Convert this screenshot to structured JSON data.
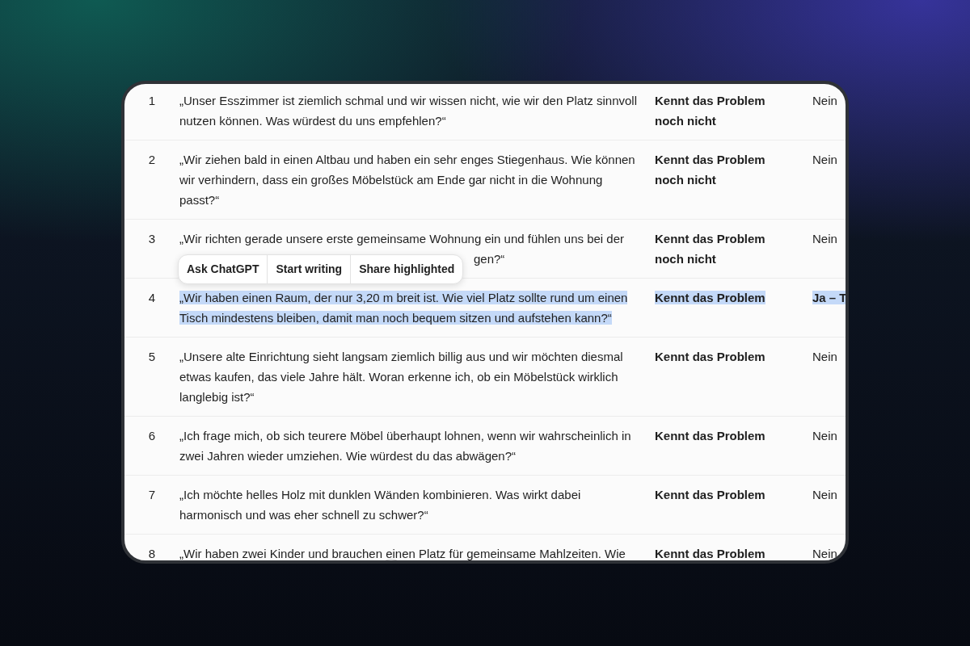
{
  "rows": [
    {
      "number": "1",
      "question": "„Unser Esszimmer ist ziemlich schmal und wir wissen nicht, wie wir den Platz sinnvoll nutzen können. Was würdest du uns empfehlen?“",
      "status": "Kennt das Problem noch nicht",
      "answer": "Nein",
      "selected": false
    },
    {
      "number": "2",
      "question": "„Wir ziehen bald in einen Altbau und haben ein sehr enges Stiegenhaus. Wie können wir verhindern, dass ein großes Möbelstück am Ende gar nicht in die Wohnung passt?“",
      "status": "Kennt das Problem noch nicht",
      "answer": "Nein",
      "selected": false
    },
    {
      "number": "3",
      "question": "„Wir richten gerade unsere erste gemeinsame Wohnung ein und fühlen uns bei der",
      "question_tail": "gen?“",
      "status": "Kennt das Problem noch nicht",
      "answer": "Nein",
      "selected": false
    },
    {
      "number": "4",
      "question": "„Wir haben einen Raum, der nur 3,20 m breit ist. Wie viel Platz sollte rund um einen Tisch mindestens bleiben, damit man noch bequem sitzen und aufstehen kann?“",
      "status": "Kennt das Problem",
      "answer": "Ja – T",
      "selected": true
    },
    {
      "number": "5",
      "question": "„Unsere alte Einrichtung sieht langsam ziemlich billig aus und wir möchten diesmal etwas kaufen, das viele Jahre hält. Woran erkenne ich, ob ein Möbelstück wirklich langlebig ist?“",
      "status": "Kennt das Problem",
      "answer": "Nein",
      "selected": false
    },
    {
      "number": "6",
      "question": "„Ich frage mich, ob sich teurere Möbel überhaupt lohnen, wenn wir wahrscheinlich in zwei Jahren wieder umziehen. Wie würdest du das abwägen?“",
      "status": "Kennt das Problem",
      "answer": "Nein",
      "selected": false
    },
    {
      "number": "7",
      "question": "„Ich möchte helles Holz mit dunklen Wänden kombinieren. Was wirkt dabei harmonisch und was eher schnell zu schwer?“",
      "status": "Kennt das Problem",
      "answer": "Nein",
      "selected": false
    },
    {
      "number": "8",
      "question": "„Wir haben zwei Kinder und brauchen einen Platz für gemeinsame Mahlzeiten. Wie",
      "status": "Kennt das Problem",
      "answer": "Nein",
      "selected": false
    }
  ],
  "selection_toolbar": {
    "buttons": [
      "Ask ChatGPT",
      "Start writing",
      "Share highlighted"
    ]
  }
}
